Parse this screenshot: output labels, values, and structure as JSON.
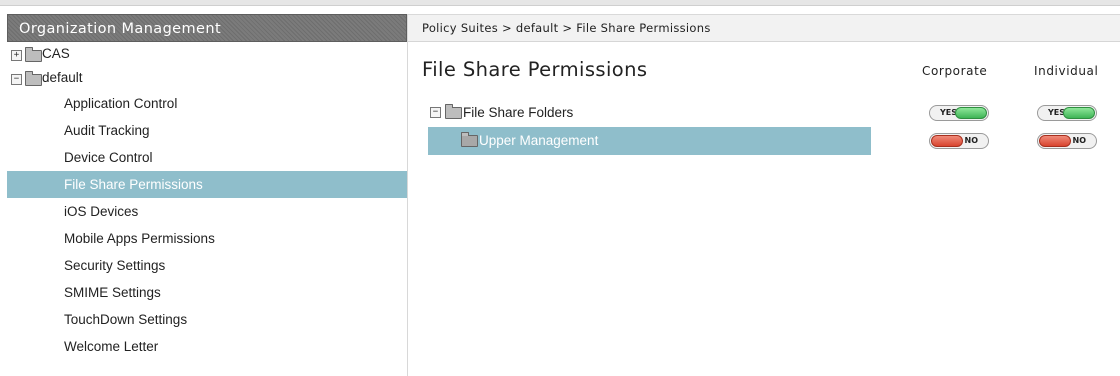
{
  "sidebar": {
    "header": "Organization Management",
    "tree": [
      {
        "label": "CAS",
        "expander": "+"
      },
      {
        "label": "default",
        "expander": "−"
      }
    ],
    "items": [
      {
        "label": "Application Control"
      },
      {
        "label": "Audit Tracking"
      },
      {
        "label": "Device Control"
      },
      {
        "label": "File Share Permissions",
        "selected": true
      },
      {
        "label": "iOS Devices"
      },
      {
        "label": "Mobile Apps Permissions"
      },
      {
        "label": "Security Settings"
      },
      {
        "label": "SMIME Settings"
      },
      {
        "label": "TouchDown Settings"
      },
      {
        "label": "Welcome Letter"
      }
    ]
  },
  "breadcrumb": "Policy Suites > default > File Share Permissions",
  "main": {
    "title": "File Share Permissions",
    "columns": [
      "Corporate",
      "Individual"
    ],
    "rows": [
      {
        "label": "File Share Folders",
        "expander": "−",
        "corporate": "YES",
        "individual": "YES"
      },
      {
        "label": "Upper Management",
        "selected": true,
        "corporate": "NO",
        "individual": "NO"
      }
    ]
  },
  "colors": {
    "selected": "#8fbecb",
    "header_bg": "#757575",
    "yes": "#3fb556",
    "no": "#d8442f"
  }
}
